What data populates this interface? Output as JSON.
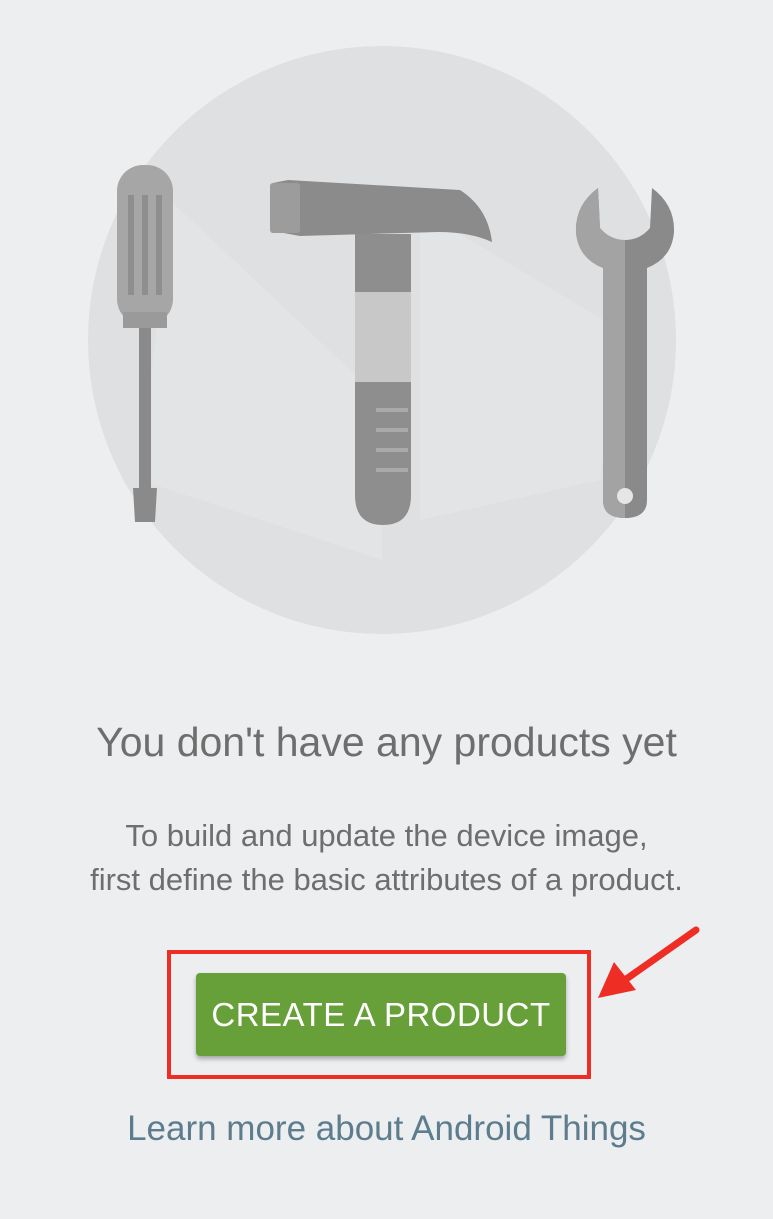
{
  "empty_state": {
    "heading": "You don't have any products yet",
    "description_line1": "To build and update the device image,",
    "description_line2": "first define the basic attributes of a product.",
    "create_button_label": "CREATE A PRODUCT",
    "learn_more_link": "Learn more about Android Things"
  },
  "illustration": {
    "icons": [
      "screwdriver-icon",
      "hammer-icon",
      "wrench-icon"
    ]
  },
  "colors": {
    "page_background": "#eceef0",
    "circle": "#dfe0e2",
    "button_green": "#67a038",
    "annotation_red": "#ee2e24",
    "link": "#5d7d8e",
    "text_gray": "#6e6e6e"
  }
}
